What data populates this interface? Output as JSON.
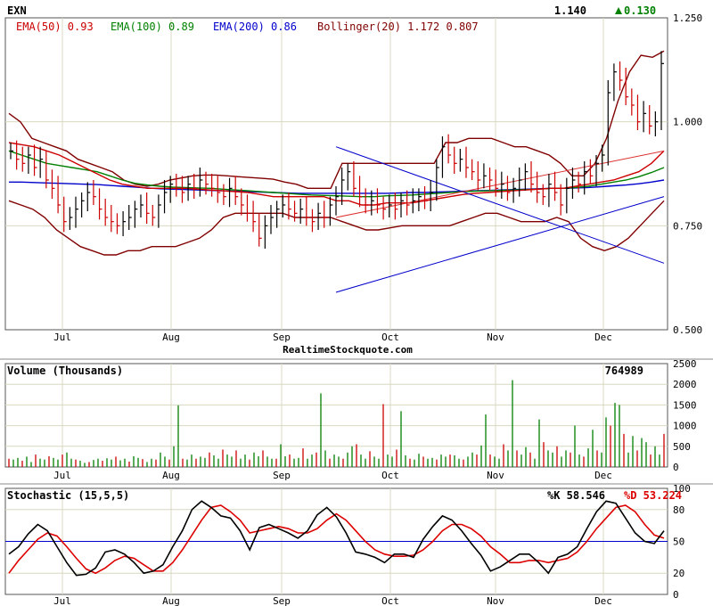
{
  "chart_data": [
    {
      "type": "line",
      "panel": "price",
      "title": "EXN",
      "last_price": "1.140",
      "change": "0.130",
      "change_color": "#008000",
      "months": [
        "Jul",
        "Aug",
        "Sep",
        "Oct",
        "Nov",
        "Dec"
      ],
      "yticks": [
        "1.250",
        "1.000",
        "0.750",
        "0.500"
      ],
      "ylim": [
        0.5,
        1.25
      ],
      "grid": true,
      "legend": [
        {
          "text": "EMA(50) 0.93",
          "color": "#cc0000"
        },
        {
          "text": "EMA(100) 0.89",
          "color": "#008000"
        },
        {
          "text": "EMA(200) 0.86",
          "color": "#0000cc"
        },
        {
          "text": "Bollinger(20) 1.172 0.807",
          "color": "#800000"
        }
      ],
      "close": [
        0.93,
        0.91,
        0.9,
        0.92,
        0.89,
        0.91,
        0.86,
        0.84,
        0.8,
        0.76,
        0.77,
        0.79,
        0.81,
        0.83,
        0.82,
        0.79,
        0.77,
        0.76,
        0.75,
        0.76,
        0.77,
        0.79,
        0.8,
        0.78,
        0.77,
        0.8,
        0.83,
        0.85,
        0.84,
        0.83,
        0.85,
        0.84,
        0.86,
        0.85,
        0.84,
        0.83,
        0.82,
        0.84,
        0.82,
        0.8,
        0.78,
        0.76,
        0.72,
        0.75,
        0.77,
        0.79,
        0.8,
        0.79,
        0.78,
        0.79,
        0.77,
        0.76,
        0.78,
        0.77,
        0.8,
        0.82,
        0.86,
        0.88,
        0.84,
        0.82,
        0.8,
        0.81,
        0.8,
        0.79,
        0.8,
        0.79,
        0.81,
        0.8,
        0.81,
        0.82,
        0.81,
        0.83,
        0.89,
        0.94,
        0.92,
        0.9,
        0.91,
        0.89,
        0.88,
        0.86,
        0.87,
        0.86,
        0.84,
        0.85,
        0.83,
        0.84,
        0.86,
        0.88,
        0.85,
        0.83,
        0.82,
        0.85,
        0.83,
        0.8,
        0.84,
        0.86,
        0.85,
        0.88,
        0.87,
        0.9,
        0.92,
        1.07,
        1.12,
        1.1,
        1.06,
        1.04,
        1.0,
        1.02,
        0.99,
        1.0,
        1.14
      ],
      "ema50": [
        0.95,
        0.945,
        0.94,
        0.93,
        0.92,
        0.905,
        0.89,
        0.875,
        0.86,
        0.85,
        0.845,
        0.84,
        0.84,
        0.84,
        0.84,
        0.838,
        0.836,
        0.834,
        0.832,
        0.83,
        0.825,
        0.82,
        0.82,
        0.82,
        0.82,
        0.82,
        0.81,
        0.81,
        0.8,
        0.8,
        0.805,
        0.805,
        0.805,
        0.81,
        0.815,
        0.82,
        0.825,
        0.828,
        0.83,
        0.832,
        0.834,
        0.836,
        0.838,
        0.84,
        0.84,
        0.845,
        0.85,
        0.855,
        0.86,
        0.87,
        0.88,
        0.9,
        0.93
      ],
      "ema100": [
        0.93,
        0.92,
        0.91,
        0.9,
        0.895,
        0.89,
        0.885,
        0.88,
        0.87,
        0.86,
        0.852,
        0.848,
        0.845,
        0.843,
        0.842,
        0.841,
        0.84,
        0.838,
        0.836,
        0.834,
        0.832,
        0.83,
        0.828,
        0.826,
        0.824,
        0.823,
        0.822,
        0.821,
        0.82,
        0.82,
        0.822,
        0.823,
        0.824,
        0.826,
        0.828,
        0.83,
        0.832,
        0.833,
        0.834,
        0.835,
        0.836,
        0.837,
        0.838,
        0.84,
        0.84,
        0.842,
        0.845,
        0.85,
        0.855,
        0.86,
        0.868,
        0.878,
        0.89
      ],
      "ema200": [
        0.855,
        0.855,
        0.854,
        0.853,
        0.852,
        0.851,
        0.85,
        0.849,
        0.847,
        0.845,
        0.843,
        0.841,
        0.839,
        0.838,
        0.837,
        0.836,
        0.835,
        0.834,
        0.833,
        0.832,
        0.831,
        0.83,
        0.829,
        0.828,
        0.828,
        0.828,
        0.828,
        0.828,
        0.828,
        0.828,
        0.828,
        0.829,
        0.83,
        0.83,
        0.831,
        0.832,
        0.833,
        0.834,
        0.835,
        0.836,
        0.837,
        0.838,
        0.839,
        0.84,
        0.84,
        0.841,
        0.842,
        0.844,
        0.846,
        0.848,
        0.851,
        0.855,
        0.86
      ],
      "boll_upper": [
        1.02,
        1.0,
        0.96,
        0.95,
        0.94,
        0.93,
        0.91,
        0.9,
        0.89,
        0.88,
        0.86,
        0.85,
        0.845,
        0.85,
        0.86,
        0.865,
        0.87,
        0.872,
        0.872,
        0.87,
        0.868,
        0.866,
        0.864,
        0.862,
        0.855,
        0.85,
        0.84,
        0.84,
        0.84,
        0.9,
        0.9,
        0.9,
        0.9,
        0.9,
        0.9,
        0.9,
        0.9,
        0.9,
        0.95,
        0.95,
        0.96,
        0.96,
        0.96,
        0.95,
        0.94,
        0.94,
        0.93,
        0.92,
        0.9,
        0.87,
        0.87,
        0.9,
        0.96,
        1.05,
        1.12,
        1.16,
        1.155,
        1.17
      ],
      "boll_lower": [
        0.81,
        0.8,
        0.79,
        0.77,
        0.74,
        0.72,
        0.7,
        0.69,
        0.68,
        0.68,
        0.69,
        0.69,
        0.7,
        0.7,
        0.7,
        0.71,
        0.72,
        0.74,
        0.77,
        0.78,
        0.78,
        0.78,
        0.78,
        0.78,
        0.77,
        0.77,
        0.77,
        0.77,
        0.76,
        0.75,
        0.74,
        0.74,
        0.745,
        0.75,
        0.75,
        0.75,
        0.75,
        0.75,
        0.76,
        0.77,
        0.78,
        0.78,
        0.77,
        0.76,
        0.76,
        0.76,
        0.77,
        0.76,
        0.72,
        0.7,
        0.69,
        0.7,
        0.72,
        0.75,
        0.78,
        0.81
      ],
      "channel_upper": [
        [
          0.94,
          1.0
        ],
        [
          0.66,
          1.17
        ]
      ],
      "channel_mid": [
        [
          0.77,
          1.0
        ],
        [
          0.93,
          1.17
        ]
      ],
      "channel_lower": [
        [
          0.59,
          1.0
        ],
        [
          0.82,
          1.17
        ]
      ],
      "channel_color": "#0000cc",
      "trend_color": "#dd3333",
      "bar_up_color": "#000000",
      "bar_down_color": "#cc0000"
    },
    {
      "type": "bar",
      "panel": "volume",
      "title": "Volume (Thousands)",
      "last_value": "764989",
      "yticks": [
        "2500",
        "2000",
        "1500",
        "1000",
        "500",
        "0"
      ],
      "ylim": [
        0,
        2500
      ],
      "values": [
        200,
        180,
        220,
        150,
        250,
        120,
        300,
        200,
        180,
        260,
        220,
        180,
        300,
        350,
        200,
        180,
        150,
        100,
        120,
        170,
        200,
        150,
        210,
        180,
        250,
        160,
        200,
        130,
        260,
        220,
        190,
        120,
        200,
        180,
        350,
        250,
        180,
        500,
        1490,
        200,
        180,
        300,
        200,
        250,
        220,
        350,
        280,
        200,
        420,
        300,
        250,
        400,
        200,
        300,
        180,
        350,
        260,
        400,
        250,
        200,
        200,
        550,
        260,
        300,
        200,
        220,
        450,
        200,
        300,
        350,
        1780,
        400,
        200,
        300,
        250,
        200,
        350,
        500,
        550,
        300,
        200,
        380,
        250,
        200,
        1520,
        300,
        250,
        420,
        1350,
        280,
        200,
        180,
        320,
        250,
        200,
        220,
        180,
        300,
        250,
        300,
        280,
        200,
        180,
        250,
        350,
        300,
        520,
        1270,
        300,
        250,
        200,
        550,
        400,
        2100,
        400,
        300,
        480,
        350,
        200,
        1150,
        600,
        400,
        350,
        500,
        250,
        400,
        350,
        1000,
        300,
        250,
        450,
        900,
        400,
        350,
        1200,
        1000,
        1550,
        1500,
        800,
        350,
        750,
        400,
        700,
        600,
        300,
        500,
        300,
        800
      ]
    },
    {
      "type": "line",
      "panel": "stochastic",
      "title": "Stochastic (15,5,5)",
      "k_label": "%K 58.546",
      "d_label": "%D 53.224",
      "k_color": "#000000",
      "d_color": "#dd0000",
      "reference_line": 50,
      "yticks": [
        "100",
        "80",
        "50",
        "20",
        "0"
      ],
      "ylim": [
        0,
        100
      ],
      "k": [
        38,
        45,
        57,
        66,
        60,
        45,
        30,
        18,
        19,
        25,
        40,
        42,
        38,
        30,
        20,
        22,
        28,
        45,
        60,
        80,
        88,
        82,
        74,
        72,
        60,
        42,
        63,
        66,
        62,
        58,
        53,
        60,
        75,
        82,
        73,
        58,
        40,
        38,
        35,
        30,
        38,
        38,
        35,
        52,
        64,
        74,
        70,
        60,
        48,
        37,
        22,
        26,
        32,
        38,
        38,
        30,
        20,
        35,
        38,
        45,
        62,
        78,
        88,
        86,
        72,
        58,
        50,
        48,
        60
      ],
      "d": [
        20,
        32,
        42,
        52,
        58,
        55,
        45,
        34,
        24,
        20,
        25,
        32,
        36,
        34,
        28,
        22,
        22,
        30,
        42,
        56,
        70,
        82,
        84,
        78,
        70,
        58,
        60,
        62,
        64,
        62,
        58,
        58,
        62,
        70,
        76,
        70,
        60,
        50,
        42,
        38,
        36,
        36,
        37,
        42,
        50,
        60,
        66,
        66,
        62,
        55,
        45,
        38,
        30,
        30,
        32,
        32,
        30,
        32,
        34,
        40,
        50,
        62,
        72,
        82,
        84,
        78,
        66,
        56,
        53
      ]
    }
  ],
  "footer": "RealtimeStockquote.com"
}
